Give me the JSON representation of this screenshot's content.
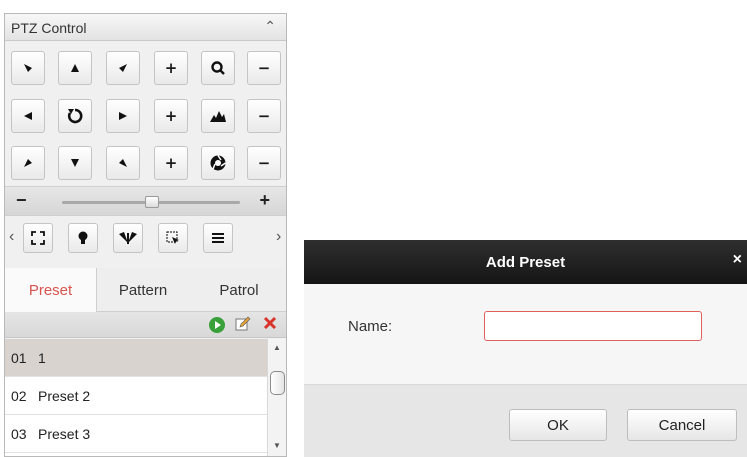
{
  "ptz": {
    "title": "PTZ Control",
    "tabs": [
      "Preset",
      "Pattern",
      "Patrol"
    ],
    "presets": [
      {
        "no": "01",
        "name": "1"
      },
      {
        "no": "02",
        "name": "Preset 2"
      },
      {
        "no": "03",
        "name": "Preset 3"
      }
    ],
    "grid_icons": [
      [
        "arrow-up-left-icon",
        "arrow-up-icon",
        "arrow-up-right-icon",
        "plus-icon",
        "zoom-icon",
        "minus-icon"
      ],
      [
        "arrow-left-icon",
        "auto-scan-icon",
        "arrow-right-icon",
        "plus-icon",
        "focus-icon",
        "minus-icon"
      ],
      [
        "arrow-down-left-icon",
        "arrow-down-icon",
        "arrow-down-right-icon",
        "plus-icon",
        "iris-icon",
        "minus-icon"
      ]
    ],
    "tool_icons": [
      "fullscreen-icon",
      "light-icon",
      "wiper-icon",
      "3d-zoom-icon",
      "menu-icon"
    ],
    "selected_color": "#d9d3cf",
    "active_tab_color": "#d9534f"
  },
  "dialog": {
    "title": "Add Preset",
    "name_label": "Name:",
    "name_value": "",
    "ok_label": "OK",
    "cancel_label": "Cancel",
    "titlebar_color": "#1f1f1f",
    "input_border_color": "#e0605c"
  }
}
